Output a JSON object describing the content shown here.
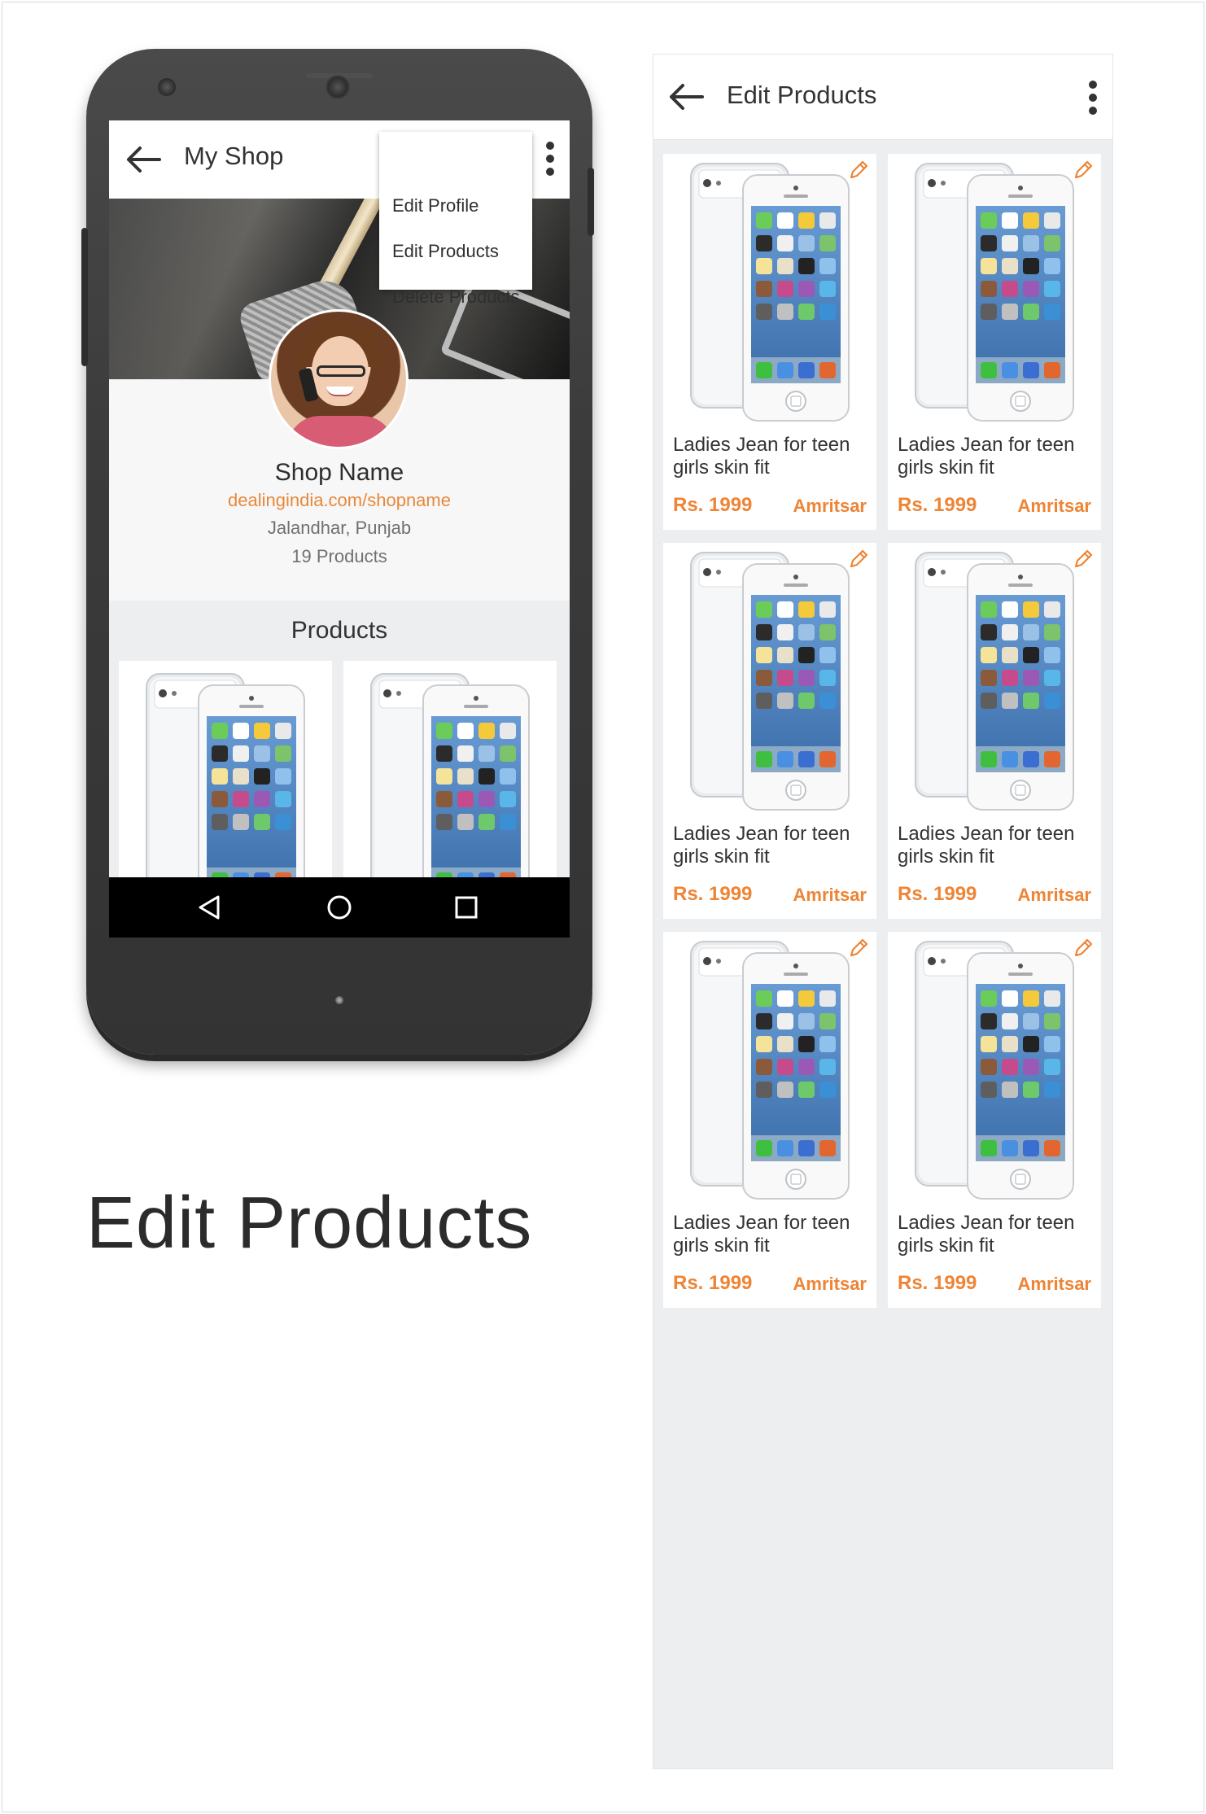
{
  "colors": {
    "accent": "#ee8434",
    "link": "#e8883a",
    "panel_bg": "#eceef0",
    "text": "#333333"
  },
  "phone": {
    "appbar": {
      "title": "My Shop",
      "back_icon": "arrow-left-icon",
      "more_icon": "more-vert-icon"
    },
    "menu": {
      "items": [
        "Edit Profile",
        "Edit Products",
        "Delete Products"
      ]
    },
    "shop": {
      "name": "Shop Name",
      "url": "dealingindia.com/shopname",
      "location": "Jalandhar, Punjab",
      "count": "19 Products"
    },
    "products_heading": "Products",
    "navbar": {
      "icons": [
        "nav-back-icon",
        "nav-home-icon",
        "nav-recents-icon"
      ]
    }
  },
  "caption": "Edit Products",
  "edit_screen": {
    "appbar": {
      "title": "Edit Products",
      "back_icon": "arrow-left-icon",
      "more_icon": "more-vert-icon"
    },
    "products": [
      {
        "name": "Ladies Jean for teen girls skin fit",
        "price": "Rs. 1999",
        "city": "Amritsar"
      },
      {
        "name": "Ladies Jean for teen girls skin fit",
        "price": "Rs. 1999",
        "city": "Amritsar"
      },
      {
        "name": "Ladies Jean for teen girls skin fit",
        "price": "Rs. 1999",
        "city": "Amritsar"
      },
      {
        "name": "Ladies Jean for teen girls skin fit",
        "price": "Rs. 1999",
        "city": "Amritsar"
      },
      {
        "name": "Ladies Jean for teen girls skin fit",
        "price": "Rs. 1999",
        "city": "Amritsar"
      },
      {
        "name": "Ladies Jean for teen girls skin fit",
        "price": "Rs. 1999",
        "city": "Amritsar"
      }
    ]
  }
}
